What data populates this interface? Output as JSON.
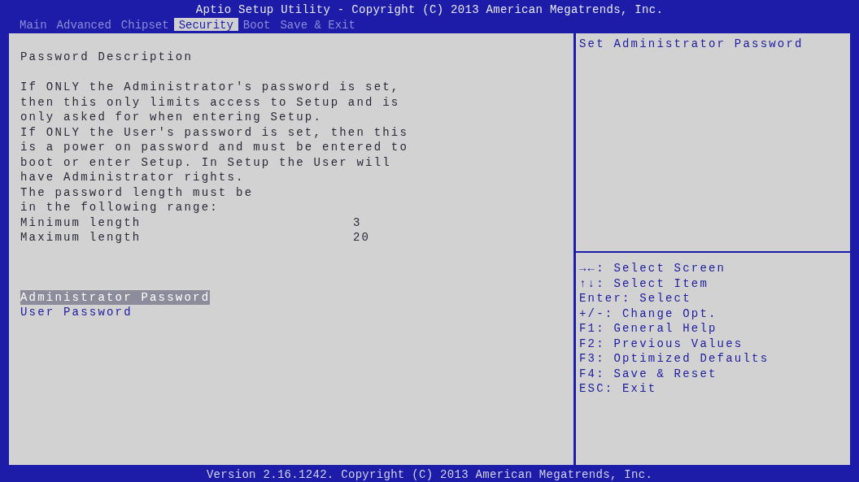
{
  "header": {
    "title": "Aptio Setup Utility - Copyright (C) 2013 American Megatrends, Inc."
  },
  "tabs": [
    {
      "label": "Main",
      "selected": false
    },
    {
      "label": "Advanced",
      "selected": false
    },
    {
      "label": "Chipset",
      "selected": false
    },
    {
      "label": "Security",
      "selected": true
    },
    {
      "label": "Boot",
      "selected": false
    },
    {
      "label": "Save & Exit",
      "selected": false
    }
  ],
  "main": {
    "heading": "Password Description",
    "paragraph_lines": [
      "If ONLY the Administrator's password is set,",
      "then this only limits access to Setup and is",
      "only asked for when entering Setup.",
      "If ONLY the User's password is set, then this",
      "is a power on password and must be entered to",
      "boot or enter Setup. In Setup the User will",
      "have Administrator rights.",
      "The password length must be",
      "in the following range:"
    ],
    "settings": [
      {
        "label": "Minimum length",
        "value": "3"
      },
      {
        "label": "Maximum length",
        "value": "20"
      }
    ],
    "menu_items": [
      {
        "label": "Administrator Password",
        "selected": true
      },
      {
        "label": "User Password",
        "selected": false
      }
    ]
  },
  "help": {
    "description": "Set Administrator Password",
    "keys": [
      "→←: Select Screen",
      "↑↓: Select Item",
      "Enter: Select",
      "+/-: Change Opt.",
      "F1: General Help",
      "F2: Previous Values",
      "F3: Optimized Defaults",
      "F4: Save & Reset",
      "ESC: Exit"
    ]
  },
  "footer": {
    "text": "Version 2.16.1242. Copyright (C) 2013 American Megatrends, Inc."
  }
}
